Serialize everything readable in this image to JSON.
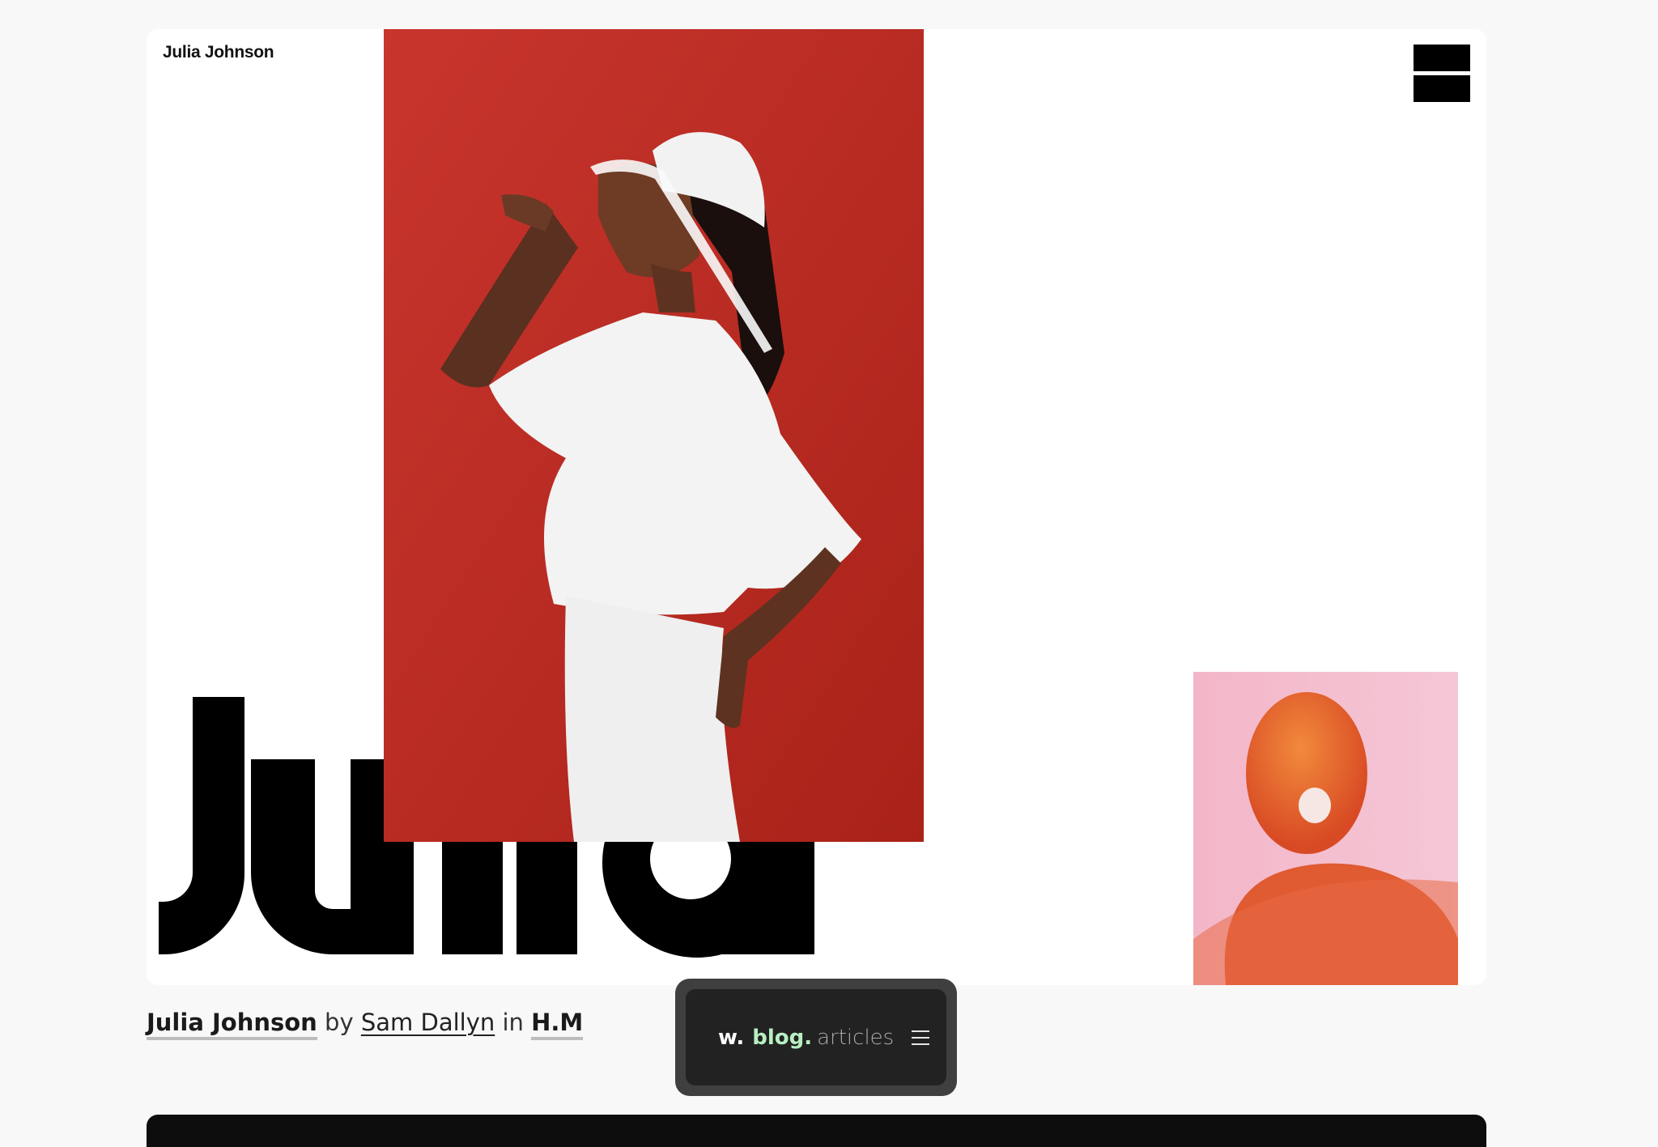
{
  "header": {
    "brand": "Julia Johnson",
    "menu_icon": "hamburger-blocks-icon"
  },
  "hero": {
    "headline_word": "Julia",
    "main_photo": "woman in white visor on red background",
    "side_photo": "orange tinted portrait on pink background"
  },
  "caption": {
    "title": "Julia Johnson",
    "by": "by",
    "author": "Sam Dallyn",
    "in": "in",
    "category": "H.M"
  },
  "blog_widget": {
    "w": "w.",
    "blog": "blog.",
    "articles": "articles",
    "menu_icon": "hamburger-icon"
  },
  "colors": {
    "background": "#f8f8f8",
    "card": "#ffffff",
    "red": "#c4312b",
    "pill_outer": "#3f3f3f",
    "pill_inner": "#222222",
    "blog_accent": "#b8efc2",
    "footer": "#0d0d0d"
  }
}
